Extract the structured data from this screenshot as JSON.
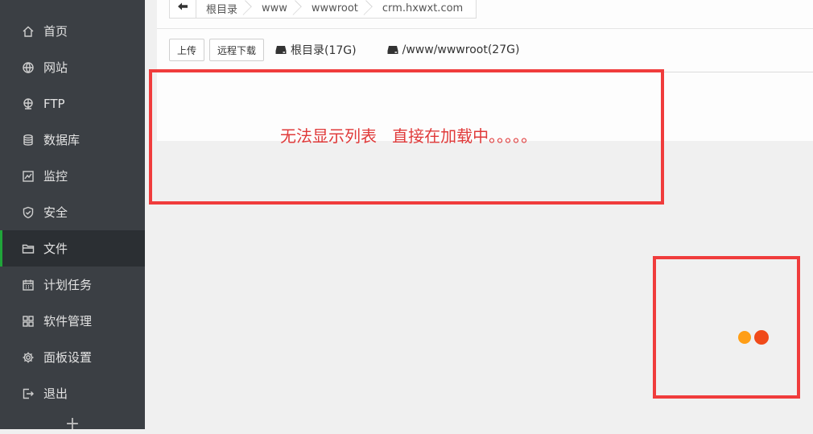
{
  "sidebar": {
    "items": [
      {
        "label": "首页",
        "icon": "home-icon"
      },
      {
        "label": "网站",
        "icon": "globe-icon"
      },
      {
        "label": "FTP",
        "icon": "network-icon"
      },
      {
        "label": "数据库",
        "icon": "database-icon"
      },
      {
        "label": "监控",
        "icon": "monitor-chart-icon"
      },
      {
        "label": "安全",
        "icon": "shield-icon"
      },
      {
        "label": "文件",
        "icon": "folder-icon",
        "active": true
      },
      {
        "label": "计划任务",
        "icon": "calendar-icon"
      },
      {
        "label": "软件管理",
        "icon": "grid-icon"
      },
      {
        "label": "面板设置",
        "icon": "gear-icon"
      },
      {
        "label": "退出",
        "icon": "logout-icon"
      }
    ],
    "plus": "+"
  },
  "breadcrumb": {
    "items": [
      "根目录",
      "www",
      "wwwroot",
      "crm.hxwxt.com"
    ]
  },
  "toolbar": {
    "upload_label": "上传",
    "remote_download_label": "远程下载",
    "disks": [
      "根目录(17G)",
      "/www/wwwroot(27G)"
    ]
  },
  "annotation": {
    "message": "无法显示列表   直接在加载中。。。。。"
  },
  "colors": {
    "accent": "#20a53a",
    "annotation": "#f03c3c",
    "loader_dot_1": "#ff9e16",
    "loader_dot_2": "#f04a1a"
  }
}
